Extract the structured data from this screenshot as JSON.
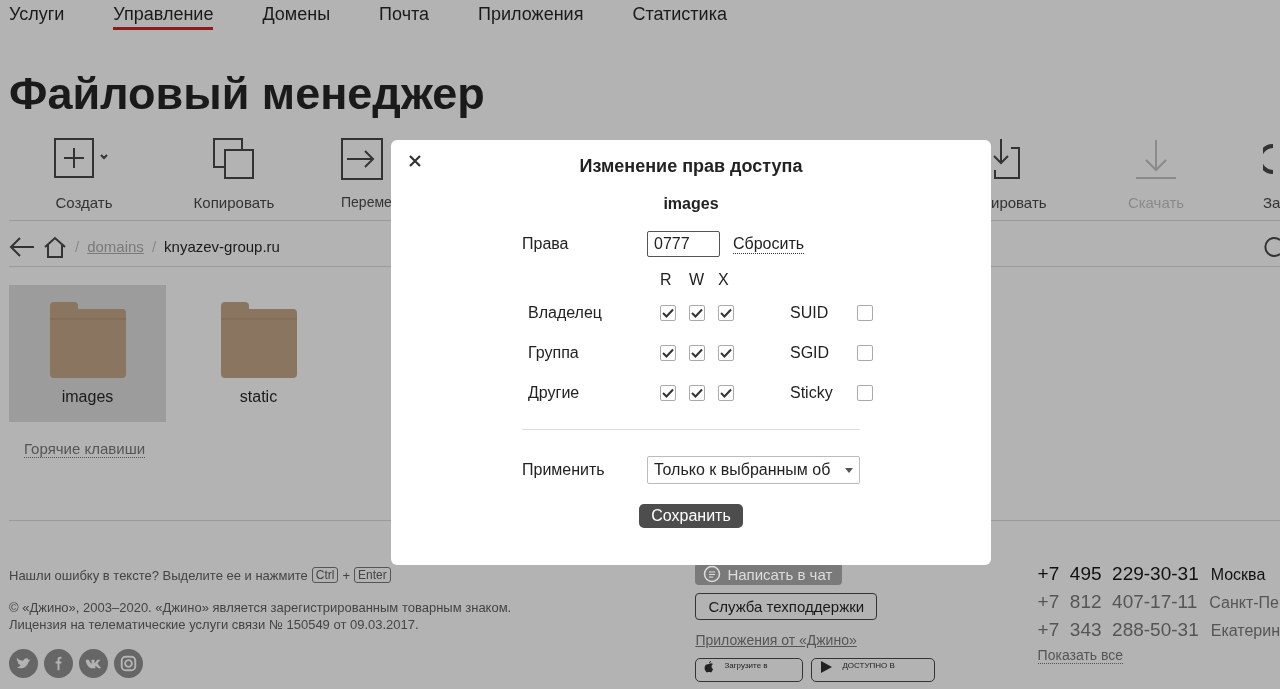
{
  "nav": [
    {
      "label": "Услуги",
      "selected": false
    },
    {
      "label": "Управление",
      "selected": true
    },
    {
      "label": "Домены",
      "selected": false
    },
    {
      "label": "Почта",
      "selected": false
    },
    {
      "label": "Приложения",
      "selected": false
    },
    {
      "label": "Статистика",
      "selected": false
    }
  ],
  "page_title": "Файловый менеджер",
  "toolbar_left": [
    {
      "kind": "create",
      "label": "Создать",
      "disabled": false
    },
    {
      "kind": "copy",
      "label": "Копировать",
      "disabled": false
    },
    {
      "kind": "move",
      "label": "Переме",
      "disabled": false
    }
  ],
  "toolbar_right": [
    {
      "kind": "upload",
      "label": "ировать",
      "disabled": false
    },
    {
      "kind": "download",
      "label": "Скачать",
      "disabled": true
    },
    {
      "kind": "archive",
      "label": "За",
      "disabled": false
    }
  ],
  "breadcrumb": {
    "separators": [
      "/",
      "/"
    ],
    "link": "domains",
    "current": "knyazev-group.ru"
  },
  "files": [
    {
      "name": "images",
      "selected": true
    },
    {
      "name": "static",
      "selected": false
    }
  ],
  "hotkeys_link": "Горячие клавиши",
  "footer": {
    "typo_note": "Нашли ошибку в тексте? Выделите ее и нажмите",
    "keys": [
      "Ctrl",
      "Enter"
    ],
    "plus": "+",
    "copyright": "© «Джино», 2003–2020. «Джино» является зарегистрированным товарным знаком.",
    "license": "Лицензия на телематические услуги связи № 150549 от 09.03.2017.",
    "chat_button": "Написать в чат",
    "support_button": "Служба техподдержки",
    "apps_link": "Приложения от «Джино»",
    "stores": [
      "Загрузите в",
      "ДОСТУПНО В"
    ],
    "phones": [
      {
        "number": "+7  495  229-30-31",
        "city": "Москва",
        "primary": true
      },
      {
        "number": "+7  812  407-17-11",
        "city": "Санкт-Пе",
        "primary": false
      },
      {
        "number": "+7  343  288-50-31",
        "city": "Екатерин",
        "primary": false
      }
    ],
    "show_all": "Показать все"
  },
  "dialog": {
    "title": "Изменение прав доступа",
    "filename": "images",
    "mode": {
      "label": "Права",
      "value": "0777",
      "reset": "Сбросить"
    },
    "columns": [
      "R",
      "W",
      "X"
    ],
    "rows": [
      {
        "label": "Владелец",
        "perms": [
          {
            "checked": true
          },
          {
            "checked": true
          },
          {
            "checked": true
          }
        ],
        "special": {
          "label": "SUID",
          "checked": false
        }
      },
      {
        "label": "Группа",
        "perms": [
          {
            "checked": true
          },
          {
            "checked": true
          },
          {
            "checked": true
          }
        ],
        "special": {
          "label": "SGID",
          "checked": false
        }
      },
      {
        "label": "Другие",
        "perms": [
          {
            "checked": true
          },
          {
            "checked": true
          },
          {
            "checked": true
          }
        ],
        "special": {
          "label": "Sticky",
          "checked": false
        }
      }
    ],
    "apply": {
      "label": "Применить",
      "value": "Только к выбранным об"
    },
    "save": "Сохранить"
  }
}
